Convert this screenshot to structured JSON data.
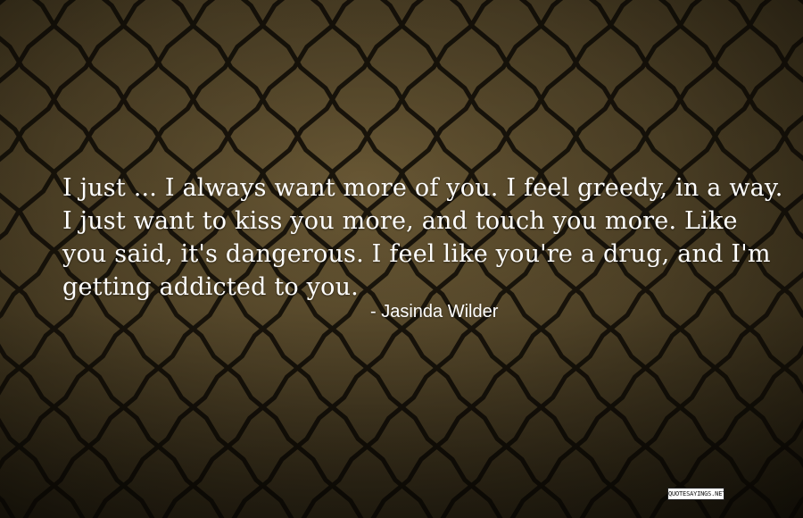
{
  "quote": {
    "lines": [
      "I just ... I always want more of you. I feel greedy, in a way.",
      "I just want to kiss you more, and touch you more. Like",
      "you said, it's dangerous. I feel like you're a drug, and I'm",
      "getting addicted to you."
    ],
    "author": "- Jasinda Wilder"
  },
  "watermark": {
    "text": "QUOTESAYINGS.NET"
  },
  "background": {
    "description_icon": "chain-link-fence-background",
    "colors": {
      "sky_light": "#6b5a36",
      "sky_dark": "#1a150b",
      "fence": "#0a0805"
    }
  }
}
